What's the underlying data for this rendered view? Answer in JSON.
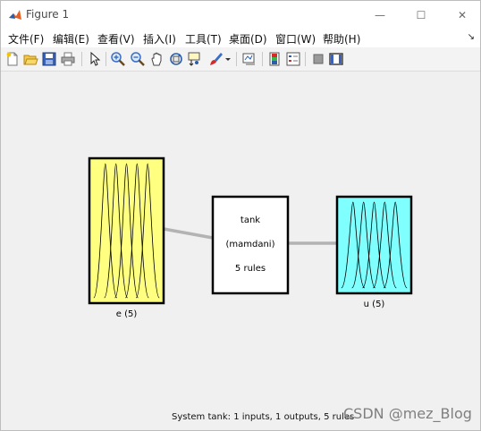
{
  "window": {
    "title": "Figure 1",
    "controls": {
      "minimize": "—",
      "maximize": "☐",
      "close": "✕"
    }
  },
  "menu": {
    "items": [
      "文件(F)",
      "编辑(E)",
      "查看(V)",
      "插入(I)",
      "工具(T)",
      "桌面(D)",
      "窗口(W)",
      "帮助(H)"
    ],
    "overflow": "↘"
  },
  "toolbar": {
    "icons": [
      "new-figure-icon",
      "open-file-icon",
      "save-icon",
      "print-icon",
      "pointer-icon",
      "zoom-in-icon",
      "zoom-out-icon",
      "pan-icon",
      "rotate-3d-icon",
      "data-cursor-icon",
      "brush-icon",
      "brush-dropdown-icon",
      "link-plot-icon",
      "colorbar-icon",
      "legend-icon",
      "hide-plot-tools-icon",
      "show-plot-tools-icon"
    ]
  },
  "fis": {
    "input": {
      "label": "e (5)",
      "color": "#ffff80"
    },
    "system": {
      "name": "tank",
      "type": "(mamdani)",
      "rules": "5 rules"
    },
    "output": {
      "label": "u (5)",
      "color": "#80ffff"
    },
    "status": "System tank: 1 inputs, 1 outputs, 5 rules"
  },
  "watermark": "CSDN @mez_Blog"
}
